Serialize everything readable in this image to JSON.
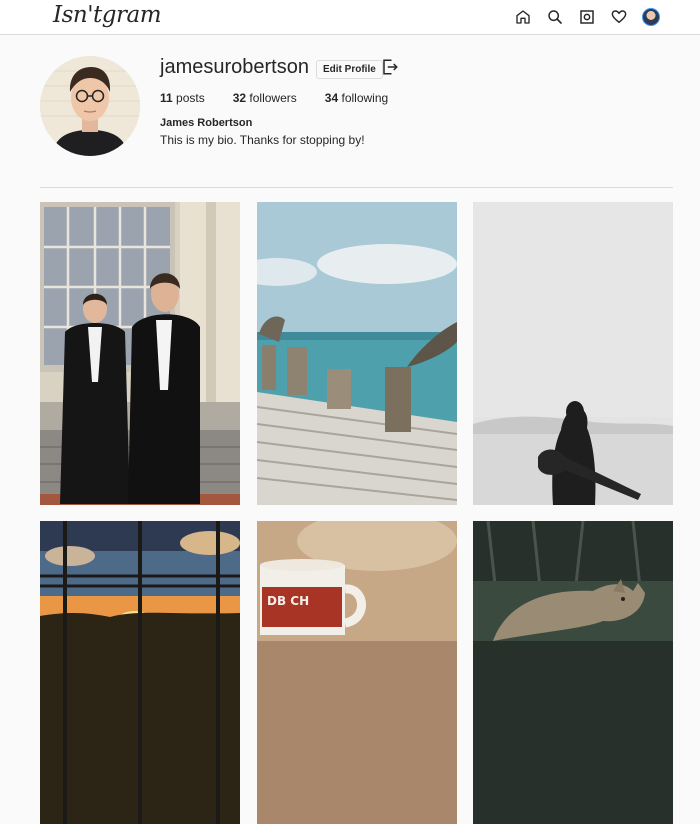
{
  "app": {
    "logo_text": "Isn'tgram"
  },
  "nav": {
    "icons": [
      "home-icon",
      "search-icon",
      "camera-icon",
      "heart-icon",
      "avatar"
    ]
  },
  "profile": {
    "username": "jamesurobertson",
    "edit_label": "Edit Profile",
    "posts_count": "11",
    "posts_label": "posts",
    "followers_count": "32",
    "followers_label": "followers",
    "following_count": "34",
    "following_label": "following",
    "full_name": "James Robertson",
    "bio": "This is my bio. Thanks for stopping by!"
  },
  "posts": [
    {
      "subject": "two men in tuxedos outside building"
    },
    {
      "subject": "wooden pier by the sea with pelican"
    },
    {
      "subject": "silhouette of guitarist in desert"
    },
    {
      "subject": "sunset through window bars"
    },
    {
      "subject": "coffee mug"
    },
    {
      "subject": "coyote in forest"
    }
  ],
  "colors": {
    "accent": "#3897f0",
    "border": "#dbdbdb",
    "background": "#fafafa"
  }
}
